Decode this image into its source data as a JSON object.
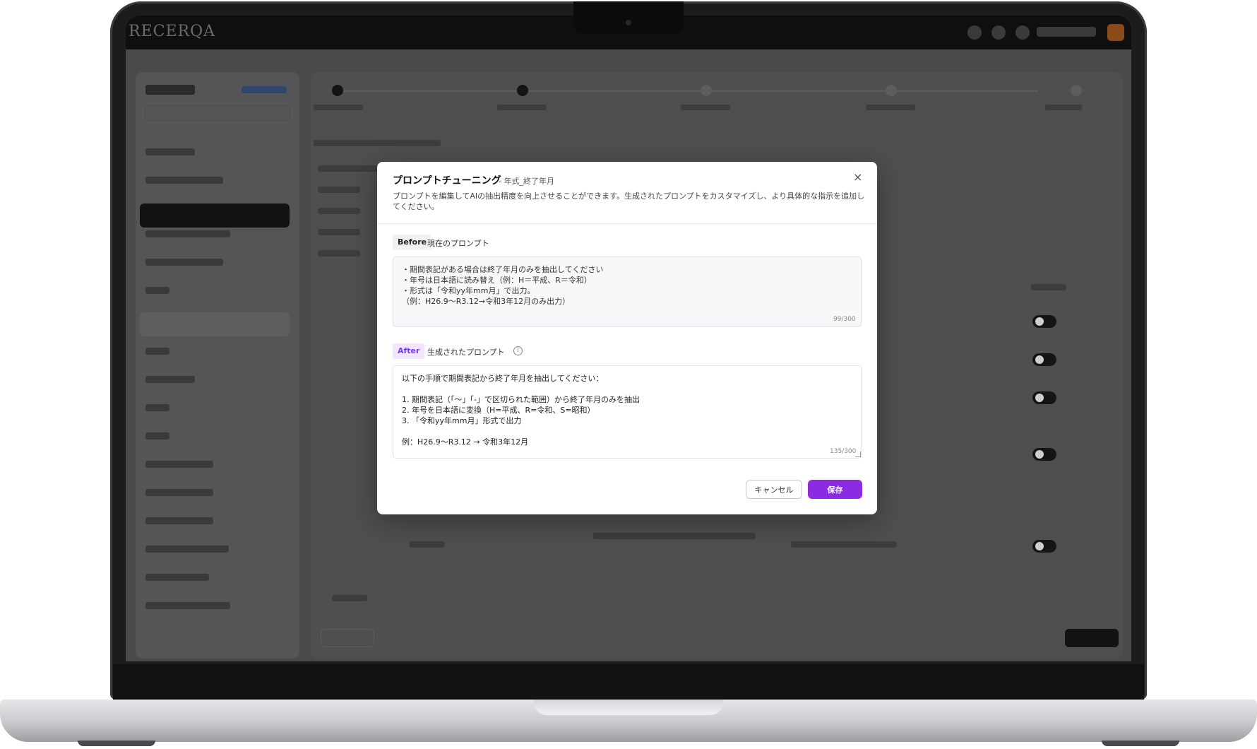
{
  "app": {
    "brand": "RECERQA"
  },
  "modal": {
    "title": "プロンプトチューニング",
    "subtitle": "- 年式_終了年月",
    "close_glyph": "×",
    "description": "プロンプトを編集してAIの抽出精度を向上させることができます。生成されたプロンプトをカスタマイズし、より具体的な指示を追加してください。",
    "before": {
      "tag": "Before",
      "label": "現在のプロンプト",
      "text": "・期間表記がある場合は終了年月のみを抽出してください\n・年号は日本語に読み替え（例：H＝平成、R＝令和）\n・形式は「令和yy年mm月」で出力。\n（例：H26.9～R3.12→令和3年12月のみ出力）",
      "count": "99/300"
    },
    "after": {
      "tag": "After",
      "label": "生成されたプロンプト",
      "info_glyph": "i",
      "text": "以下の手順で期間表記から終了年月を抽出してください：\n\n1. 期間表記（「～」「-」で区切られた範囲）から終了年月のみを抽出\n2. 年号を日本語に変換（H=平成、R=令和、S=昭和）\n3. 「令和yy年mm月」形式で出力\n\n例：H26.9～R3.12 → 令和3年12月",
      "count": "135/300"
    },
    "buttons": {
      "cancel": "キャンセル",
      "save": "保存"
    }
  },
  "colors": {
    "accent": "#8b2be2",
    "after_tag_bg": "#f1e6fd",
    "after_tag_text": "#7c3aed"
  }
}
